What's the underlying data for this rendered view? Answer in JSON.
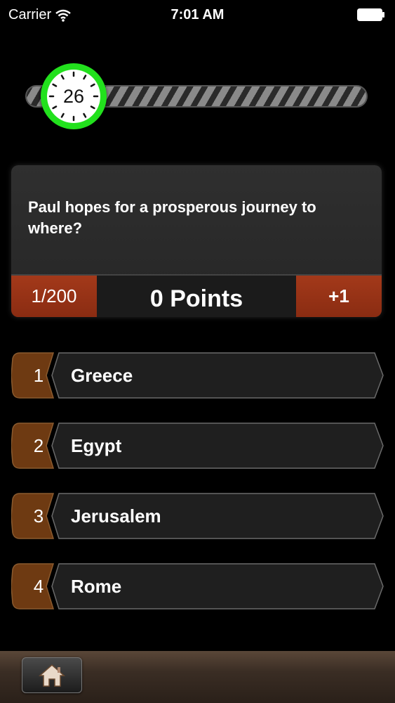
{
  "status_bar": {
    "carrier": "Carrier",
    "time": "7:01 AM",
    "wifi_icon": "wifi-icon",
    "battery_icon": "battery-icon"
  },
  "timer": {
    "seconds_remaining": "26",
    "color": "#22e11d"
  },
  "question": {
    "text": "Paul hopes for a prosperous journey to where?"
  },
  "score": {
    "progress": "1/200",
    "points": "0 Points",
    "bonus": "+1",
    "accent_color": "#a3391a"
  },
  "answers": [
    {
      "number": "1",
      "label": "Greece"
    },
    {
      "number": "2",
      "label": "Egypt"
    },
    {
      "number": "3",
      "label": "Jerusalem"
    },
    {
      "number": "4",
      "label": "Rome"
    }
  ],
  "bottom_bar": {
    "home_icon": "home-icon"
  }
}
